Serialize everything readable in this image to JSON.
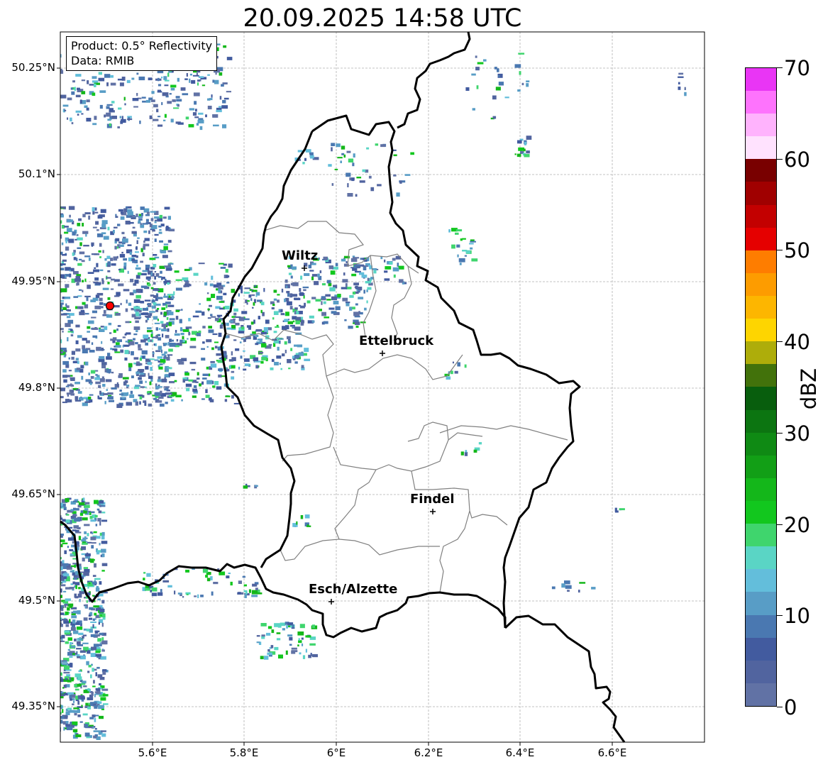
{
  "title": "20.09.2025 14:58 UTC",
  "info": {
    "product": "Product: 0.5° Reflectivity",
    "data_source": "Data: RMIB"
  },
  "axes": {
    "y_ticks": [
      "50.25°N",
      "50.1°N",
      "49.95°N",
      "49.8°N",
      "49.65°N",
      "49.5°N",
      "49.35°N"
    ],
    "x_ticks": [
      "5.6°E",
      "5.8°E",
      "6°E",
      "6.2°E",
      "6.4°E",
      "6.6°E"
    ]
  },
  "cities": [
    {
      "name": "Wiltz"
    },
    {
      "name": "Ettelbruck"
    },
    {
      "name": "Findel"
    },
    {
      "name": "Esch/Alzette"
    }
  ],
  "radar_site": {
    "color": "#ff0000"
  },
  "colorbar": {
    "label": "dBZ",
    "ticks": [
      "0",
      "10",
      "20",
      "30",
      "40",
      "50",
      "60",
      "70"
    ],
    "colors": [
      "#6172a5",
      "#51649f",
      "#425b9f",
      "#4a78b1",
      "#589dc6",
      "#63bedb",
      "#5ad5c5",
      "#3fd56d",
      "#12c71e",
      "#14b71a",
      "#129f16",
      "#0f8a14",
      "#0c7511",
      "#085e0d",
      "#42720b",
      "#aead0a",
      "#fed500",
      "#fdb600",
      "#fd9c00",
      "#fe7d00",
      "#e50000",
      "#c30000",
      "#a00000",
      "#790000",
      "#ffe2fe",
      "#ffb3fd",
      "#fe73fd",
      "#e935f5"
    ]
  }
}
